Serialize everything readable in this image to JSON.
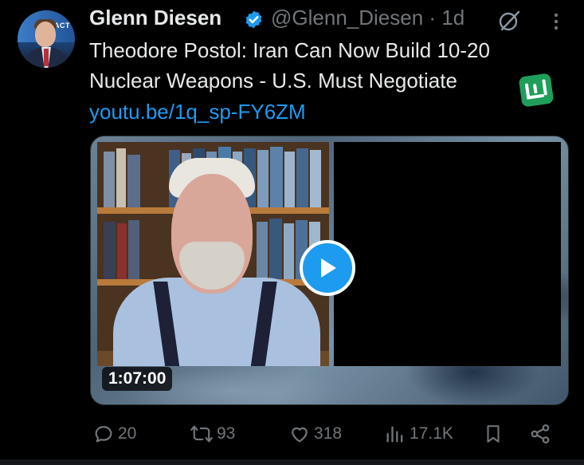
{
  "author": {
    "name": "Glenn Diesen",
    "handle": "@Glenn_Diesen",
    "time": "· 1d"
  },
  "tweet": {
    "line1": "Theodore Postol: Iran Can Now Build 10-20",
    "line2": "Nuclear Weapons - U.S. Must Negotiate",
    "link": "youtu.be/1q_sp-FY6ZM"
  },
  "media": {
    "duration": "1:07:00"
  },
  "actions": {
    "replies": "20",
    "reposts": "93",
    "likes": "318",
    "views": "17.1K"
  },
  "colors": {
    "accent": "#1d9bf0",
    "muted": "#71767b",
    "text": "#e7e9ea",
    "background": "#000000"
  },
  "icons": [
    "verified-badge-icon",
    "grok-icon",
    "more-options-icon",
    "play-icon",
    "reply-icon",
    "repost-icon",
    "like-icon",
    "views-icon",
    "bookmark-icon",
    "share-icon"
  ]
}
